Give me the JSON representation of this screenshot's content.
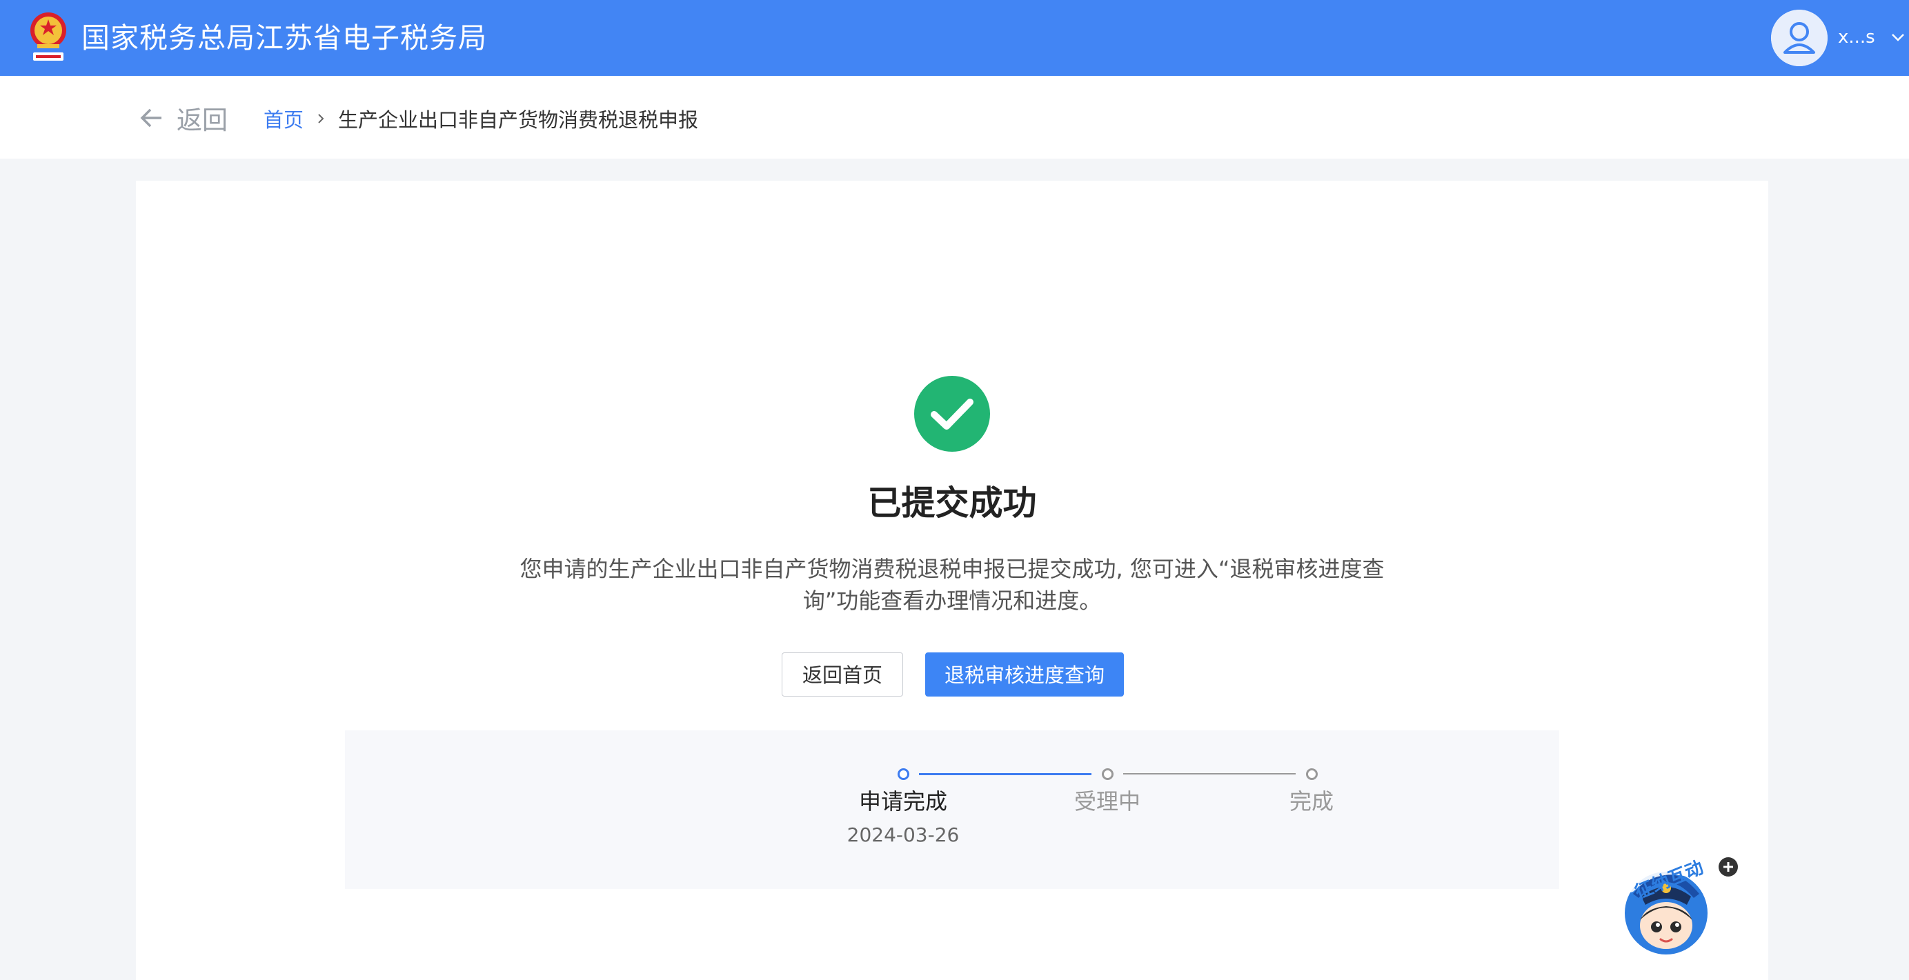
{
  "header": {
    "site_title": "国家税务总局江苏省电子税务局",
    "logo_icon": "tax-emblem-icon",
    "user": {
      "name": "x...s",
      "avatar_icon": "user-avatar-icon"
    },
    "bar_color": "#4285f4"
  },
  "nav": {
    "back_label": "返回",
    "breadcrumb": {
      "home": "首页",
      "current": "生产企业出口非自产货物消费税退税申报"
    }
  },
  "result": {
    "status_icon": "check-circle-icon",
    "status_color": "#22b573",
    "title": "已提交成功",
    "description": "您申请的生产企业出口非自产货物消费税退税申报已提交成功, 您可进入“退税审核进度查询”功能查看办理情况和进度。",
    "buttons": {
      "home": "返回首页",
      "query": "退税审核进度查询"
    }
  },
  "steps": [
    {
      "label": "申请完成",
      "date": "2024-03-26",
      "state": "done"
    },
    {
      "label": "受理中",
      "date": "",
      "state": "pending"
    },
    {
      "label": "完成",
      "date": "",
      "state": "pending"
    }
  ],
  "assistant": {
    "label": "征纳互动",
    "icon": "mascot-icon",
    "plus_icon": "plus-icon"
  },
  "colors": {
    "accent": "#3d85f5",
    "link": "#3d7cf0",
    "step_active": "#3d7cf0",
    "step_inactive": "#999999"
  }
}
